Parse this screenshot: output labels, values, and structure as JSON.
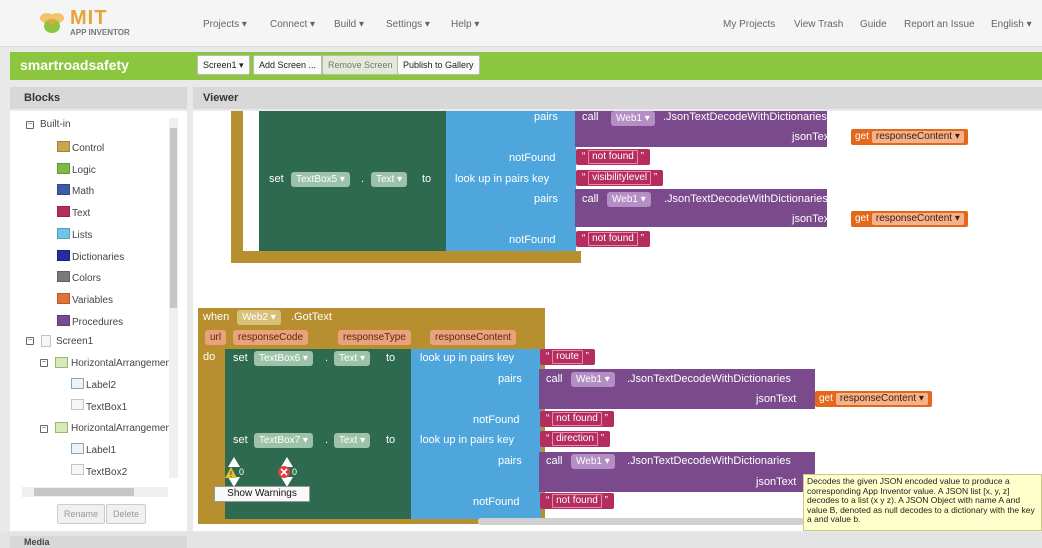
{
  "app": {
    "logo_title": "MIT",
    "logo_subtitle": "APP INVENTOR"
  },
  "nav": {
    "left": [
      "Projects ▾",
      "Connect ▾",
      "Build ▾",
      "Settings ▾",
      "Help ▾"
    ],
    "right": [
      "My Projects",
      "View Trash",
      "Guide",
      "Report an Issue",
      "English ▾"
    ]
  },
  "project": {
    "name": "smartroadsafety",
    "screen_select": "Screen1 ▾",
    "add_screen": "Add Screen ...",
    "remove_screen": "Remove Screen",
    "publish": "Publish to Gallery"
  },
  "panels": {
    "blocks": "Blocks",
    "viewer": "Viewer",
    "media": "Media"
  },
  "tree": {
    "builtin": "Built-in",
    "categories": [
      {
        "label": "Control",
        "color": "#c8a64e"
      },
      {
        "label": "Logic",
        "color": "#7dbb47"
      },
      {
        "label": "Math",
        "color": "#3b5ba7"
      },
      {
        "label": "Text",
        "color": "#b32d5e"
      },
      {
        "label": "Lists",
        "color": "#6ec4e9"
      },
      {
        "label": "Dictionaries",
        "color": "#2a2aa0"
      },
      {
        "label": "Colors",
        "color": "#7a7a7a"
      },
      {
        "label": "Variables",
        "color": "#e07338"
      },
      {
        "label": "Procedures",
        "color": "#7b4a8c"
      }
    ],
    "screen": "Screen1",
    "items": [
      {
        "label": "HorizontalArrangemen",
        "level": 1
      },
      {
        "label": "Label2",
        "level": 2
      },
      {
        "label": "TextBox1",
        "level": 2
      },
      {
        "label": "HorizontalArrangemen",
        "level": 1
      },
      {
        "label": "Label1",
        "level": 2
      },
      {
        "label": "TextBox2",
        "level": 2
      }
    ],
    "rename": "Rename",
    "delete": "Delete"
  },
  "top_block": {
    "pairs_label": "pairs",
    "call": "call",
    "component": "Web1 ▾",
    "method": ".JsonTextDecodeWithDictionaries",
    "json_text": "jsonText",
    "get": "get",
    "response_content": "responseContent ▾",
    "not_found": "notFound",
    "not_found_value": "not found",
    "set": "set",
    "textbox5": "TextBox5 ▾",
    "text_prop": "Text ▾",
    "to": "to",
    "lookup": "look up in pairs  key",
    "key1": "visibilitylevel"
  },
  "event_block": {
    "when": "when",
    "component": "Web2 ▾",
    "event": ".GotText",
    "params": [
      "url",
      "responseCode",
      "responseType",
      "responseContent"
    ],
    "do": "do",
    "set": "set",
    "textbox6": "TextBox6 ▾",
    "textbox7": "TextBox7 ▾",
    "text_prop": "Text ▾",
    "to": "to",
    "lookup": "look up in pairs  key",
    "key_route": "route",
    "key_direction": "direction",
    "pairs": "pairs",
    "call": "call",
    "web1": "Web1 ▾",
    "method": ".JsonTextDecodeWithDictionaries",
    "json_text": "jsonText",
    "get": "get",
    "response_content": "responseContent ▾",
    "not_found": "notFound",
    "not_found_value": "not found"
  },
  "warnings": {
    "warn_count": "0",
    "error_count": "0",
    "show_warnings": "Show Warnings"
  },
  "tooltip": "Decodes the given JSON encoded value to produce a corresponding App Inventor value. A JSON list [x, y, z] decodes to a list (x y z). A JSON Object with name A and value B, denoted as null decodes to a dictionary with the key a and value b."
}
